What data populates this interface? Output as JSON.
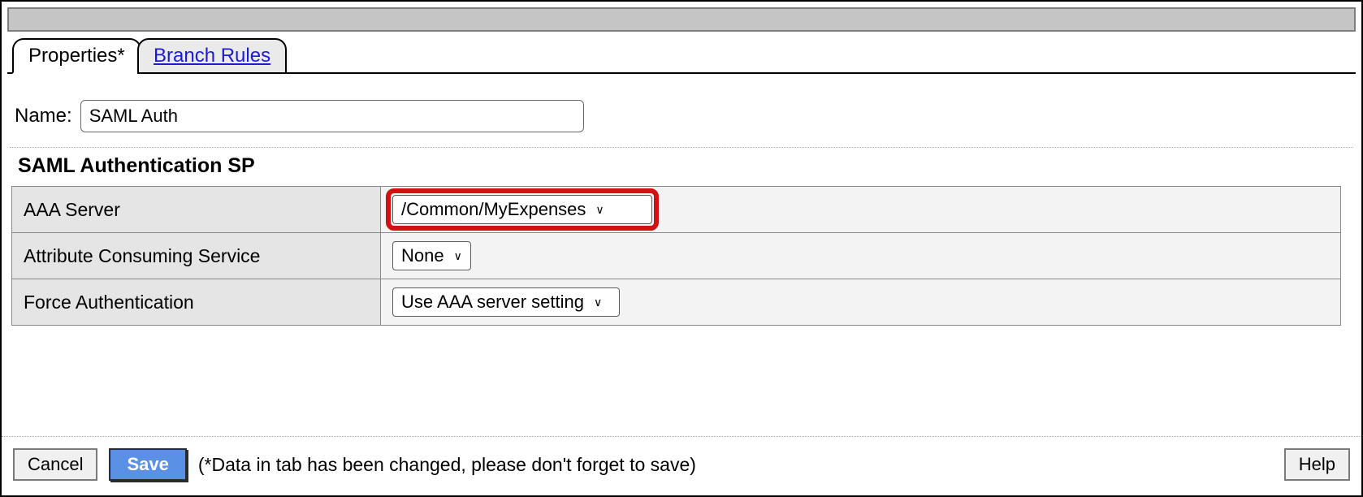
{
  "tabs": {
    "properties_label": "Properties*",
    "branch_rules_label": "Branch Rules"
  },
  "form": {
    "name_label": "Name:",
    "name_value": "SAML Auth",
    "section_title": "SAML Authentication SP",
    "rows": {
      "aaa_server": {
        "label": "AAA Server",
        "value": "/Common/MyExpenses"
      },
      "acs": {
        "label": "Attribute Consuming Service",
        "value": "None"
      },
      "force_auth": {
        "label": "Force Authentication",
        "value": "Use AAA server setting"
      }
    }
  },
  "footer": {
    "cancel_label": "Cancel",
    "save_label": "Save",
    "dirty_hint": "(*Data in tab has been changed, please don't forget to save)",
    "help_label": "Help"
  }
}
